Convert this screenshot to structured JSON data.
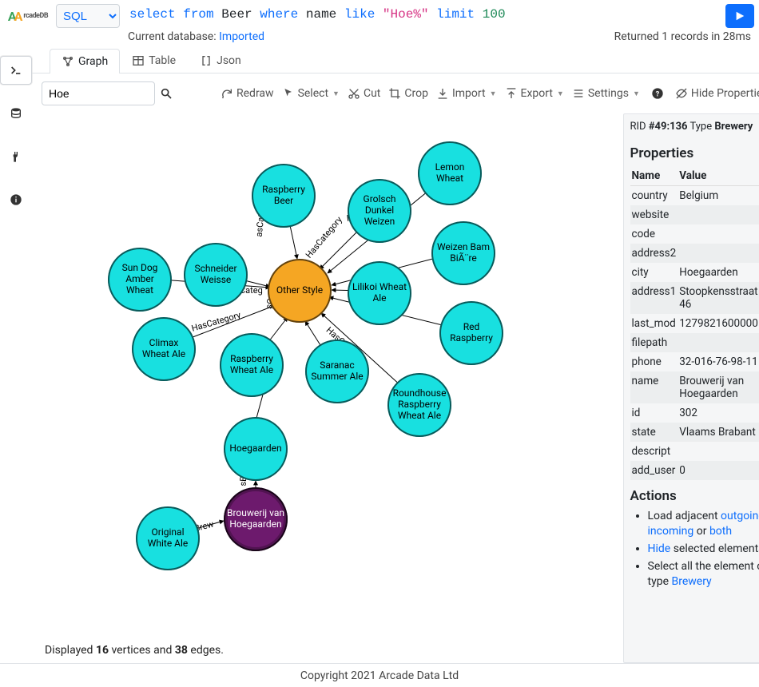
{
  "logo_text": "rcadeDB",
  "lang": "SQL",
  "query": {
    "select": "select",
    "from": "from",
    "table": "Beer",
    "where": "where",
    "field": "name",
    "like": "like",
    "value": "\"Hoe%\"",
    "limit": "limit",
    "limit_n": "100"
  },
  "status": {
    "db_label": "Current database:",
    "db_name": "Imported",
    "result": "Returned 1 records in 28ms"
  },
  "tabs": {
    "graph": "Graph",
    "table": "Table",
    "json": "Json"
  },
  "search_value": "Hoe",
  "toolbar": {
    "redraw": "Redraw",
    "select": "Select",
    "cut": "Cut",
    "crop": "Crop",
    "import": "Import",
    "export": "Export",
    "settings": "Settings",
    "hide_props": "Hide Properties"
  },
  "displayed": {
    "line1": "Displayed ",
    "v": "16",
    "mid": " vertices and ",
    "e": "38",
    "end": " edges."
  },
  "sidepanel": {
    "rid_label": "RID",
    "rid": "#49:136",
    "type_label": "Type",
    "type": "Brewery",
    "properties_title": "Properties",
    "name_header": "Name",
    "value_header": "Value",
    "rows": [
      {
        "k": "country",
        "v": "Belgium"
      },
      {
        "k": "website",
        "v": ""
      },
      {
        "k": "code",
        "v": ""
      },
      {
        "k": "address2",
        "v": ""
      },
      {
        "k": "city",
        "v": "Hoegaarden"
      },
      {
        "k": "address1",
        "v": "Stoopkensstraat 46"
      },
      {
        "k": "last_mod",
        "v": "1279821600000"
      },
      {
        "k": "filepath",
        "v": ""
      },
      {
        "k": "phone",
        "v": "32-016-76-98-11"
      },
      {
        "k": "name",
        "v": "Brouwerij van Hoegaarden"
      },
      {
        "k": "id",
        "v": "302"
      },
      {
        "k": "state",
        "v": "Vlaams Brabant"
      },
      {
        "k": "descript",
        "v": ""
      },
      {
        "k": "add_user",
        "v": "0"
      }
    ],
    "actions_title": "Actions",
    "actions": {
      "load_prefix": "Load adjacent ",
      "outgoing": "outgoing",
      "incoming": "incoming",
      "both": "both",
      "or": " or ",
      "comma": ", ",
      "hide": "Hide",
      "hide_suffix": " selected elements",
      "select_all_prefix": "Select all the element of type ",
      "brewery": "Brewery"
    }
  },
  "nodes": {
    "lemon_wheat": "Lemon Wheat",
    "raspberry_beer": "Raspberry Beer",
    "grolsch": "Grolsch Dunkel Weizen",
    "weizen_bam": "Weizen Bam BiÃ¨re",
    "sun_dog": "Sun Dog Amber Wheat",
    "schneider": "Schneider Weisse",
    "other_style": "Other Style",
    "lilikoi": "Lilikoi Wheat Ale",
    "red_raspberry": "Red Raspberry",
    "climax": "Climax Wheat Ale",
    "raspberry_wheat": "Raspberry Wheat Ale",
    "saranac": "Saranac Summer Ale",
    "roundhouse": "Roundhouse Raspberry Wheat Ale",
    "hoegaarden": "Hoegaarden",
    "brouwerij": "Brouwerij van Hoegaarden",
    "original_white": "Original White Ale"
  },
  "edge_labels": {
    "hascategory": "HasCategory",
    "cat": "Categ",
    "ascat": "asCateg",
    "sbrew": "sBrew",
    "ha": "Ha",
    "gory": "gory",
    "scategg": "sCateg"
  },
  "footer": "Copyright 2021 Arcade Data Ltd"
}
